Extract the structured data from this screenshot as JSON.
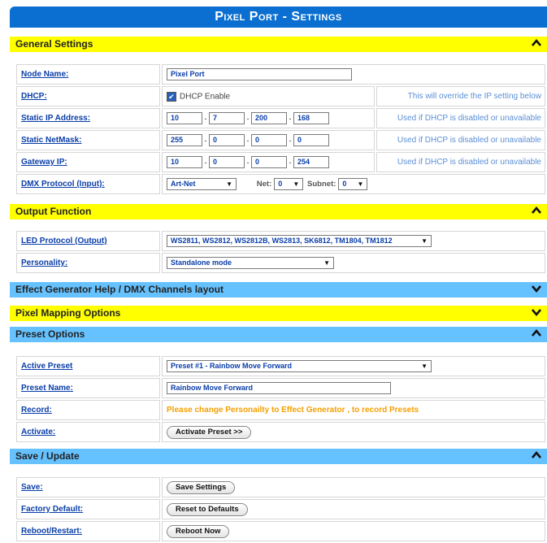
{
  "title": "Pixel Port - Settings",
  "sections": {
    "general": "General Settings",
    "output": "Output Function",
    "effect": "Effect Generator Help / DMX Channels layout",
    "pixel": "Pixel Mapping Options",
    "preset": "Preset Options",
    "save": "Save / Update"
  },
  "general": {
    "node_name_label": "Node Name:",
    "node_name_value": "Pixel Port",
    "dhcp_label": "DHCP:",
    "dhcp_checkbox_label": "DHCP Enable",
    "dhcp_checked": true,
    "dhcp_hint": "This will override the IP setting below",
    "ip_label": "Static IP Address:",
    "ip": [
      "10",
      "7",
      "200",
      "168"
    ],
    "ip_hint": "Used if DHCP is disabled or unavailable",
    "mask_label": "Static NetMask:",
    "mask": [
      "255",
      "0",
      "0",
      "0"
    ],
    "mask_hint": "Used if DHCP is disabled or unavailable",
    "gw_label": "Gateway IP:",
    "gw": [
      "10",
      "0",
      "0",
      "254"
    ],
    "gw_hint": "Used if DHCP is disabled or unavailable",
    "dmx_label": "DMX Protocol (Input):",
    "dmx_value": "Art-Net",
    "net_label": "Net:",
    "net_value": "0",
    "subnet_label": "Subnet:",
    "subnet_value": "0"
  },
  "output": {
    "led_label": "LED Protocol (Output)",
    "led_value": "WS2811, WS2812, WS2812B, WS2813, SK6812, TM1804, TM1812",
    "personality_label": "Personality:",
    "personality_value": "Standalone mode"
  },
  "preset": {
    "active_label": "Active Preset",
    "active_value": "Preset #1 - Rainbow Move Forward",
    "name_label": "Preset Name:",
    "name_value": "Rainbow Move Forward",
    "record_label": "Record:",
    "record_msg": "Please change Personailty to Effect Generator , to record Presets",
    "activate_label": "Activate:",
    "activate_button": "Activate Preset >>"
  },
  "save": {
    "save_label": "Save:",
    "save_button": "Save Settings",
    "factory_label": "Factory Default:",
    "factory_button": "Reset to Defaults",
    "reboot_label": "Reboot/Restart:",
    "reboot_button": "Reboot Now"
  },
  "icons": {
    "collapse": "chevron-up-icon",
    "expand": "chevron-down-icon"
  },
  "colors": {
    "banner": "#0a6fd0",
    "yellow_header": "#ffff00",
    "blue_header": "#66c2ff",
    "label": "#0a3ea8",
    "hint": "#5b8fd6",
    "warning": "#f5a000"
  }
}
